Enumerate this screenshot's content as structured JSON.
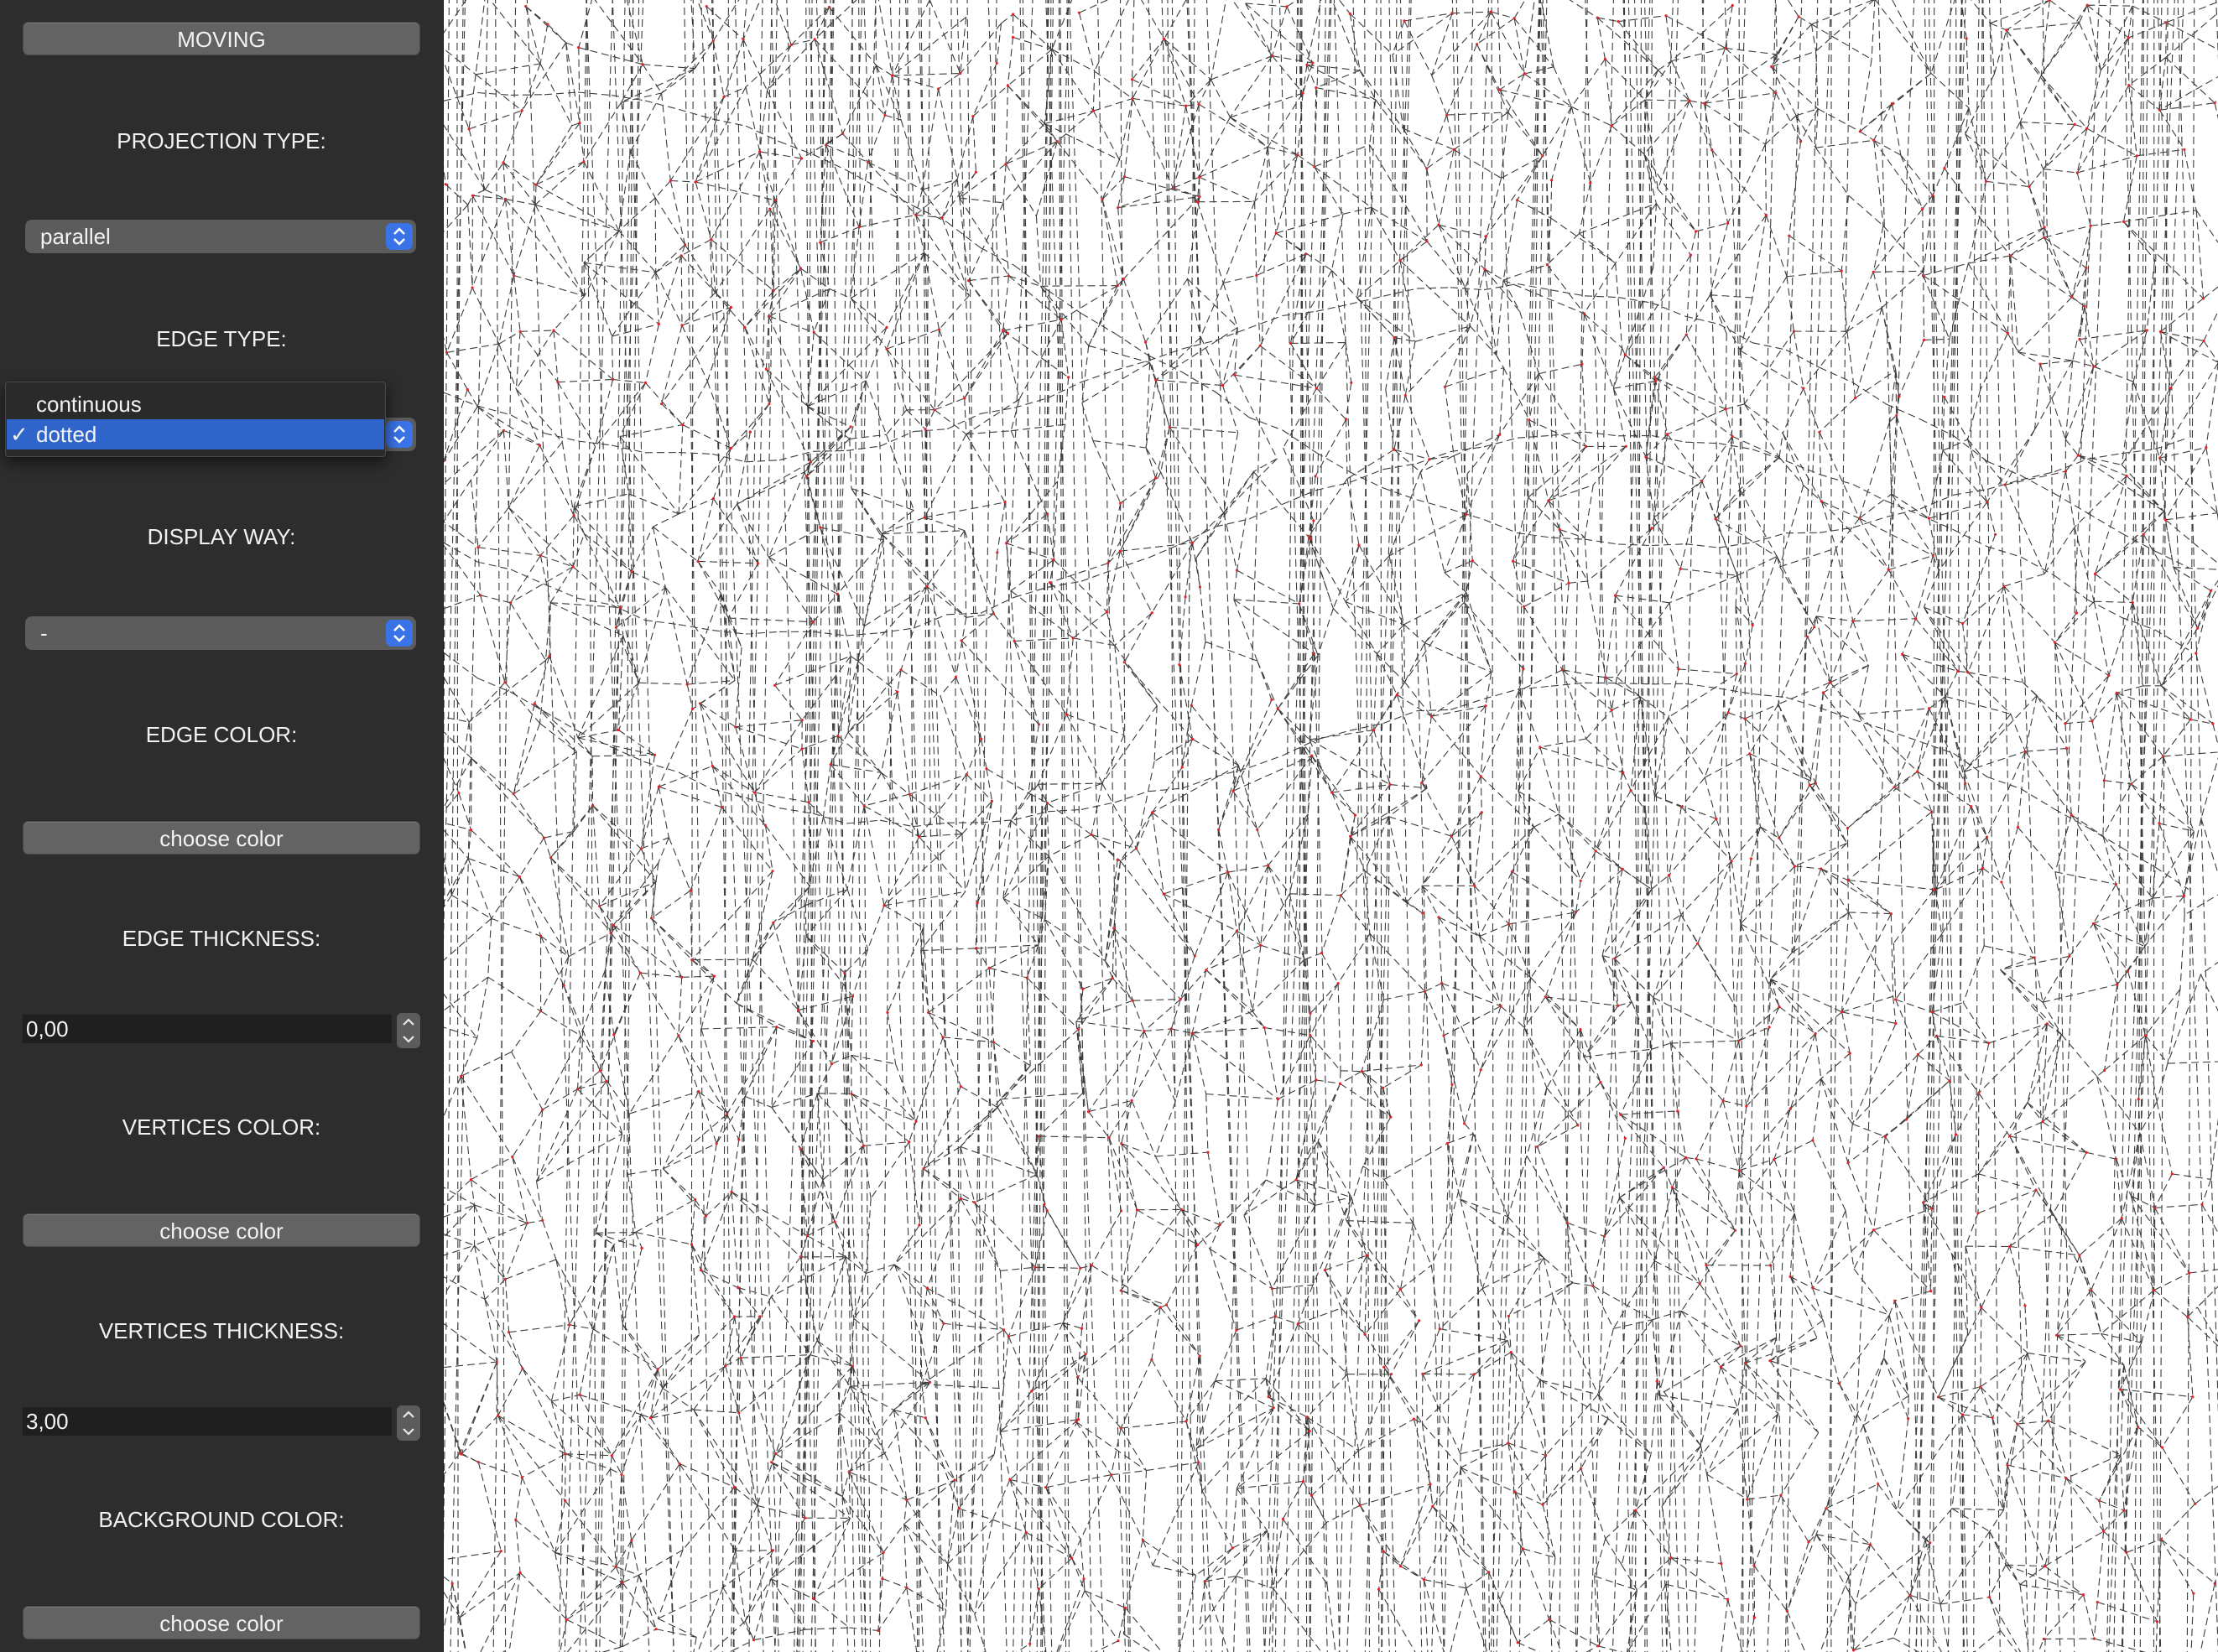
{
  "sidebar": {
    "moving_button": "MOVING",
    "projection": {
      "label": "PROJECTION TYPE:",
      "selected": "parallel"
    },
    "edge_type": {
      "label": "EDGE  TYPE:",
      "options": [
        "continuous",
        "dotted"
      ],
      "selected": "dotted",
      "check_glyph": "✓"
    },
    "display_way": {
      "label": "DISPLAY WAY:",
      "selected": "-"
    },
    "edge_color": {
      "label": "EDGE COLOR:",
      "button": "choose color"
    },
    "edge_thickness": {
      "label": "EDGE THICKNESS:",
      "value": "0,00"
    },
    "vertices_color": {
      "label": "VERTICES  COLOR:",
      "button": "choose color"
    },
    "vertices_thickness": {
      "label": "VERTICES THICKNESS:",
      "value": "3,00"
    },
    "background_color": {
      "label": "BACKGROUND COLOR:",
      "button": "choose color"
    }
  },
  "colors": {
    "sidebar_bg": "#2d2d2d",
    "accent": "#3a73e8",
    "selected_option": "#2f65ca",
    "edge_color": "#1a1a1a",
    "vertex_color": "#e0242a",
    "background": "#ffffff"
  },
  "icons": {
    "select_arrows": "chevron-up-down-icon",
    "checkmark": "checkmark-icon",
    "stepper": "stepper-arrows-icon"
  }
}
